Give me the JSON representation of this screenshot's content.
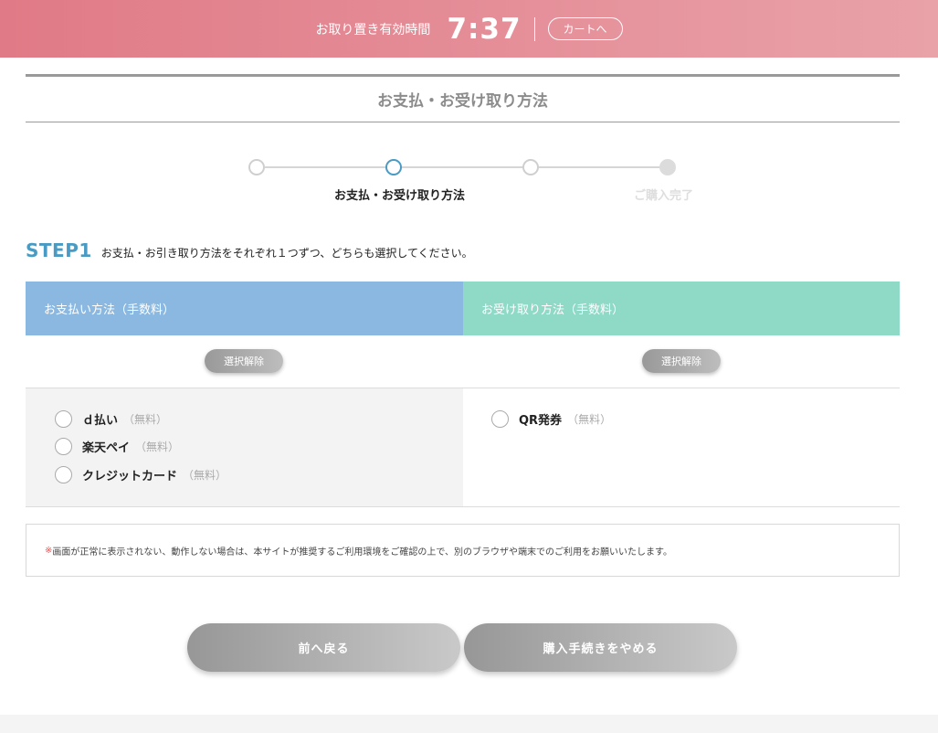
{
  "timer": {
    "label": "お取り置き有効時間",
    "value": "7:37",
    "cart_button": "カートへ"
  },
  "page_title": "お支払・お受け取り方法",
  "progress": {
    "current_label": "お支払・お受け取り方法",
    "final_label": "ご購入完了"
  },
  "step1": {
    "tag": "STEP1",
    "instruction": "お支払・お引き取り方法をそれぞれ１つずつ、どちらも選択してください。"
  },
  "payment": {
    "header": "お支払い方法（手数料）",
    "clear_label": "選択解除",
    "options": [
      {
        "name": "ｄ払い",
        "fee": "（無料）"
      },
      {
        "name": "楽天ペイ",
        "fee": "（無料）"
      },
      {
        "name": "クレジットカード",
        "fee": "（無料）"
      }
    ]
  },
  "receipt": {
    "header": "お受け取り方法（手数料）",
    "clear_label": "選択解除",
    "options": [
      {
        "name": "QR発券",
        "fee": "（無料）"
      }
    ]
  },
  "notice": {
    "mark": "※",
    "text": "画面が正常に表示されない、動作しない場合は、本サイトが推奨するご利用環境をご確認の上で、別のブラウザや端末でのご利用をお願いいたします。"
  },
  "buttons": {
    "back": "前へ戻る",
    "cancel": "購入手続きをやめる"
  },
  "colors": {
    "timer_bar": "#e07a86",
    "accent_blue": "#4a9bc3",
    "payment_header": "#8ab8e0",
    "receipt_header": "#8fd9c7",
    "notice_mark": "#e05a5a"
  }
}
